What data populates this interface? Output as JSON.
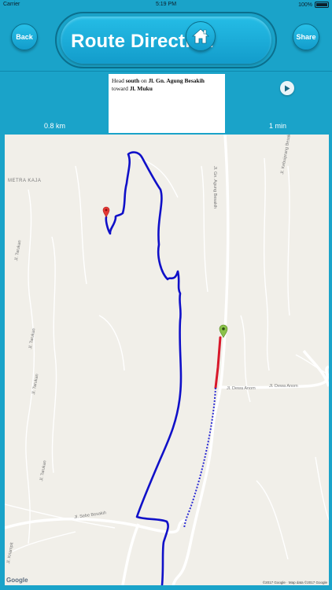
{
  "status_bar": {
    "carrier": "Carrier",
    "time": "5:19 PM",
    "battery": "100%"
  },
  "header": {
    "title": "Route Direction",
    "back_label": "Back",
    "share_label": "Share",
    "home_icon": "home-icon"
  },
  "instruction": {
    "prefix": "Head ",
    "direction": "south",
    "on_word": " on ",
    "street": "Jl. Gn. Agung Besakih",
    "toward_word": " toward ",
    "destination": "Jl. Muku",
    "distance": "0.8 km",
    "duration": "1 min",
    "next_icon": "play-icon"
  },
  "map": {
    "area_label": "METRA KAJA",
    "road_labels": {
      "gn_agung_besakih": "Jl. Gn. Agung Besakih",
      "kebuiprang_besakih": "Jl. Kebuiprang Besakih",
      "dewa_anom_1": "Jl. Dewa Anom",
      "dewa_anom_2": "Jl. Dewa Anom",
      "tarukan_1": "Jl. Tarukan",
      "tarukan_2": "Jl. Tarukan",
      "tarukan_3": "Jl. Tarukan",
      "tarukan_4": "Jl. Tarukan",
      "sebe_besakih": "Jl. Sebe Besakih",
      "kriampit": "Jl. Kriampit"
    },
    "google_logo": "Google",
    "attribution": "©2017 Google · Map data ©2017 Google",
    "route_color": "#1010c8",
    "traffic_color": "#d8182a",
    "origin_marker_color": "#e53935",
    "destination_marker_color": "#8bc34a"
  }
}
